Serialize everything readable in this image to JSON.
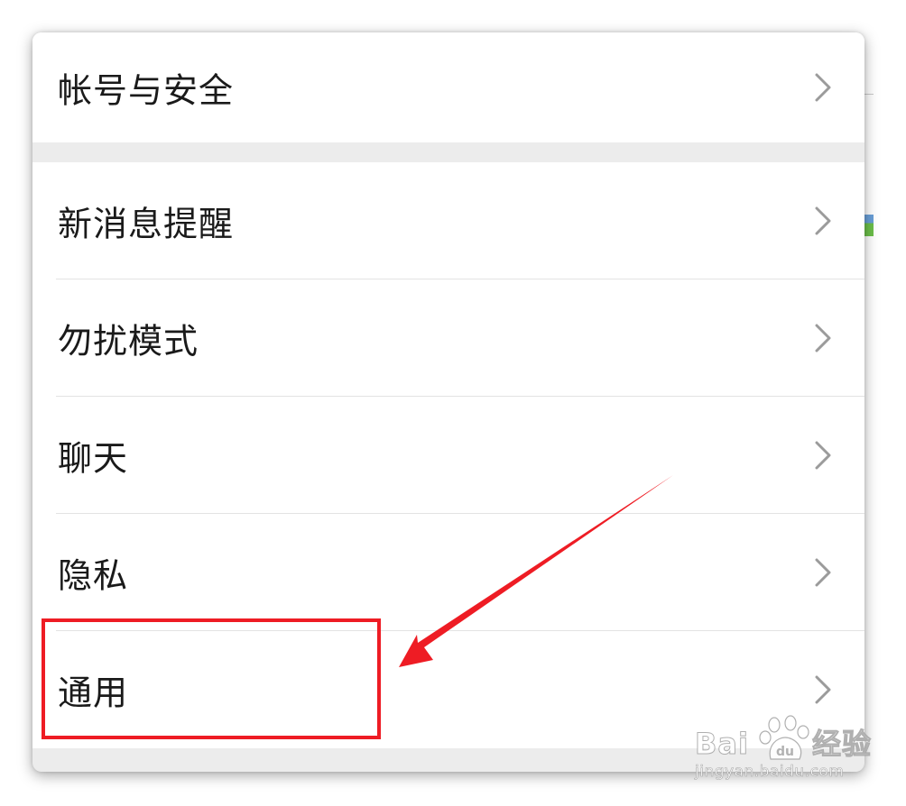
{
  "settings": {
    "items": [
      {
        "id": "account-security",
        "label": "帐号与安全"
      },
      {
        "id": "new-message-notifications",
        "label": "新消息提醒"
      },
      {
        "id": "do-not-disturb",
        "label": "勿扰模式"
      },
      {
        "id": "chat",
        "label": "聊天"
      },
      {
        "id": "privacy",
        "label": "隐私"
      },
      {
        "id": "general",
        "label": "通用"
      }
    ],
    "highlighted_item": "general"
  },
  "annotation": {
    "box_color": "#ee1c24",
    "arrow_color": "#ee1c24"
  },
  "watermark": {
    "brand_left": "Bai",
    "brand_right": "经验",
    "url": "jingyan.baidu.com"
  },
  "icons": {
    "row_chevron": "chevron-right-icon"
  }
}
